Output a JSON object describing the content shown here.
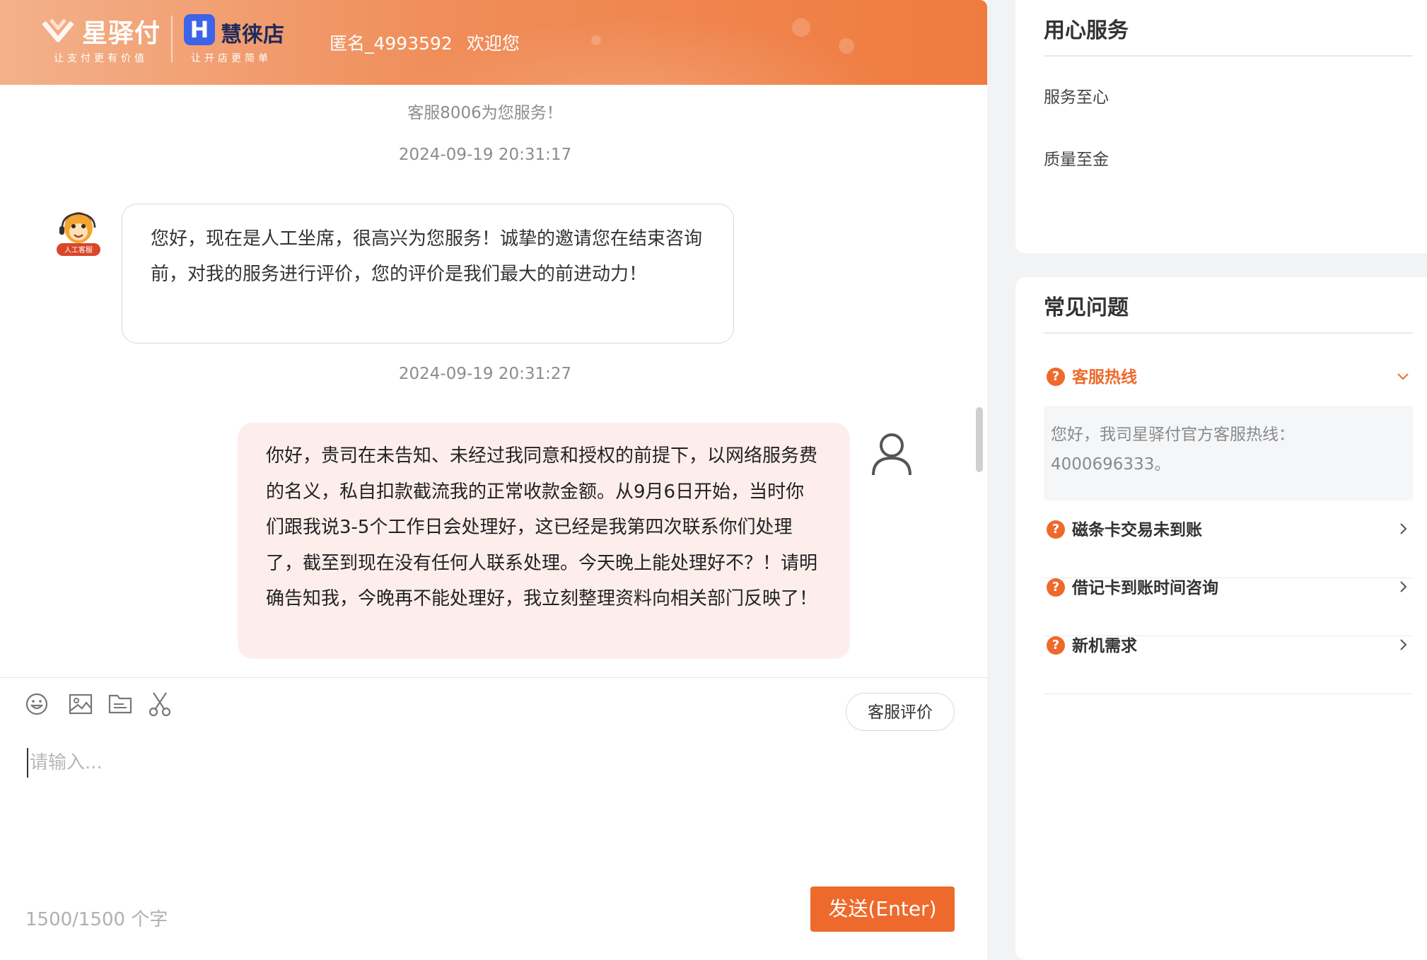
{
  "header": {
    "brand1_name": "星驿付",
    "brand1_slogan": "让支付更有价值",
    "brand2_logo_letter": "H",
    "brand2_name": "慧徕店",
    "brand2_slogan": "让开店更简单",
    "user_name": "匿名_4993592",
    "welcome_text": "欢迎您"
  },
  "chat": {
    "system_notice": "客服8006为您服务！",
    "messages": [
      {
        "timestamp": "2024-09-19 20:31:17",
        "sender": "agent",
        "avatar_badge": "人工客服",
        "text": "您好，现在是人工坐席，很高兴为您服务！诚挚的邀请您在结束咨询前，对我的服务进行评价，您的评价是我们最大的前进动力！"
      },
      {
        "timestamp": "2024-09-19 20:31:27",
        "sender": "user",
        "text": "你好，贵司在未告知、未经过我同意和授权的前提下，以网络服务费的名义，私自扣款截流我的正常收款金额。从9月6日开始，当时你们跟我说3-5个工作日会处理好，这已经是我第四次联系你们处理了，截至到现在没有任何人联系处理。今天晚上能处理好不？！请明确告知我，今晚再不能处理好，我立刻整理资料向相关部门反映了！"
      }
    ]
  },
  "composer": {
    "tools": [
      "emoji-icon",
      "image-icon",
      "file-icon",
      "scissors-icon"
    ],
    "rate_button": "客服评价",
    "placeholder": "请输入...",
    "counter": "1500/1500 个字",
    "send_button": "发送(Enter)"
  },
  "service_card": {
    "title": "用心服务",
    "items": [
      "服务至心",
      "质量至金"
    ]
  },
  "faq_card": {
    "title": "常见问题",
    "items": [
      {
        "label": "客服热线",
        "expanded": true,
        "answer": "您好，我司星驿付官方客服热线：4000696333。"
      },
      {
        "label": "磁条卡交易未到账",
        "expanded": false
      },
      {
        "label": "借记卡到账时间咨询",
        "expanded": false
      },
      {
        "label": "新机需求",
        "expanded": false
      }
    ]
  },
  "colors": {
    "accent": "#ee6a2c",
    "user_bubble": "#fdeeec",
    "brand2_blue": "#3d63e9"
  }
}
